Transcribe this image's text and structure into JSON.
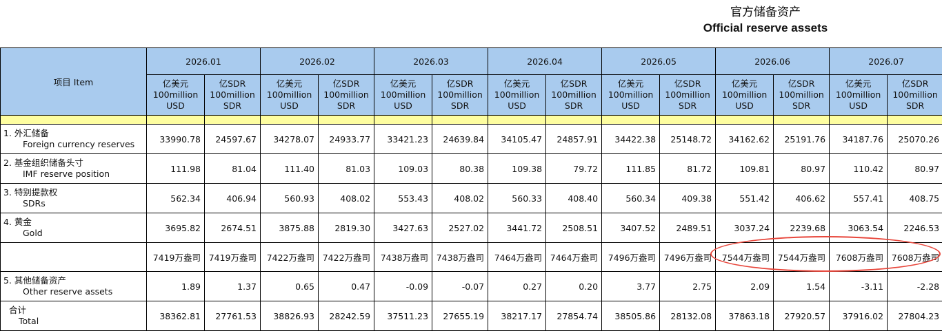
{
  "title_cn": "官方储备资产",
  "title_en": "Official reserve assets",
  "item_header": "项目 Item",
  "months": [
    "2026.01",
    "2026.02",
    "2026.03",
    "2026.04",
    "2026.05",
    "2026.06",
    "2026.07"
  ],
  "units": {
    "usd": {
      "cn": "亿美元",
      "en1": "100million",
      "en2": "USD"
    },
    "sdr": {
      "cn": "亿SDR",
      "en1": "100million",
      "en2": "SDR"
    }
  },
  "rows": {
    "fx": {
      "num_cn": "1.  外汇储备",
      "en": "Foreign currency reserves",
      "values": [
        "33990.78",
        "24597.67",
        "34278.07",
        "24933.77",
        "33421.23",
        "24639.84",
        "34105.47",
        "24857.91",
        "34422.38",
        "25148.72",
        "34162.62",
        "25191.76",
        "34187.76",
        "25070.26"
      ]
    },
    "imf": {
      "num_cn": "2.  基金组织储备头寸",
      "en": "IMF reserve position",
      "values": [
        "111.98",
        "81.04",
        "111.40",
        "81.03",
        "109.03",
        "80.38",
        "109.38",
        "79.72",
        "111.85",
        "81.72",
        "109.81",
        "80.97",
        "110.42",
        "80.97"
      ]
    },
    "sdr": {
      "num_cn": "3.  特别提款权",
      "en": "SDRs",
      "values": [
        "562.34",
        "406.94",
        "560.93",
        "408.02",
        "553.43",
        "408.02",
        "560.33",
        "408.40",
        "560.34",
        "409.38",
        "551.42",
        "406.62",
        "557.41",
        "408.75"
      ]
    },
    "gold": {
      "num_cn": "4.  黄金",
      "en": "Gold",
      "values": [
        "3695.82",
        "2674.51",
        "3875.88",
        "2819.30",
        "3427.63",
        "2527.02",
        "3441.72",
        "2508.51",
        "3407.52",
        "2489.51",
        "3037.24",
        "2239.68",
        "3063.54",
        "2246.53"
      ]
    },
    "gold_oz": {
      "values": [
        "7419万盎司",
        "7419万盎司",
        "7422万盎司",
        "7422万盎司",
        "7438万盎司",
        "7438万盎司",
        "7464万盎司",
        "7464万盎司",
        "7496万盎司",
        "7496万盎司",
        "7544万盎司",
        "7544万盎司",
        "7608万盎司",
        "7608万盎司"
      ]
    },
    "other": {
      "num_cn": "5.  其他储备资产",
      "en": "Other reserve assets",
      "values": [
        "1.89",
        "1.37",
        "0.65",
        "0.47",
        "-0.09",
        "-0.07",
        "0.27",
        "0.20",
        "3.77",
        "2.75",
        "2.09",
        "1.54",
        "-3.11",
        "-2.28"
      ]
    },
    "total": {
      "num_cn": "合计",
      "en": "Total",
      "values": [
        "38362.81",
        "27761.53",
        "38826.93",
        "28242.59",
        "37511.23",
        "27655.19",
        "38217.17",
        "27854.74",
        "38505.86",
        "28132.08",
        "37863.18",
        "27920.57",
        "37916.02",
        "27804.23"
      ]
    }
  },
  "colors": {
    "header_bg": "#a9cbee",
    "separator": "#fefea0",
    "highlight": "#e8463b"
  }
}
